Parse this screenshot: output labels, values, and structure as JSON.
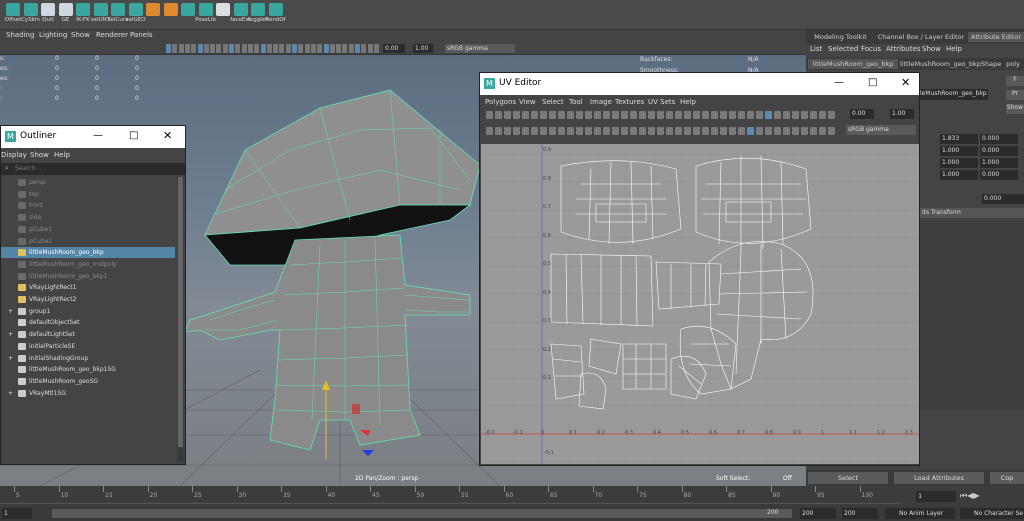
{
  "shelf": {
    "items": [
      {
        "label": "Offset",
        "icon": "teal-cube-icon",
        "color": "#3aa6a0"
      },
      {
        "label": "CySkin",
        "icon": "teal-cube-icon",
        "color": "#3aa6a0"
      },
      {
        "label": "Outl",
        "icon": "outliner-icon",
        "color": "#cfd8e0"
      },
      {
        "label": "GE",
        "icon": "graph-editor-icon",
        "color": "#cfd8e0"
      },
      {
        "label": "IK-FK",
        "icon": "teal-cube-icon",
        "color": "#3aa6a0"
      },
      {
        "label": "selUNT",
        "icon": "teal-cube-icon",
        "color": "#3aa6a0"
      },
      {
        "label": "selCurv",
        "icon": "teal-cube-icon",
        "color": "#3aa6a0"
      },
      {
        "label": "selGEO",
        "icon": "teal-cube-icon",
        "color": "#3aa6a0"
      },
      {
        "label": "",
        "icon": "orange-cube-icon",
        "color": "#e08a30"
      },
      {
        "label": "",
        "icon": "orange-cube-icon",
        "color": "#e08a30"
      },
      {
        "label": "",
        "icon": "teal-cube-icon",
        "color": "#3aa6a0"
      },
      {
        "label": "PoseLib",
        "icon": "teal-cube-icon",
        "color": "#3aa6a0"
      },
      {
        "label": "",
        "icon": "magnet-icon",
        "color": "#dddddd"
      },
      {
        "label": "faceExt",
        "icon": "teal-cube-icon",
        "color": "#3aa6a0"
      },
      {
        "label": "toggleF",
        "icon": "teal-cube-icon",
        "color": "#3aa6a0"
      },
      {
        "label": "RendOf",
        "icon": "teal-cube-icon",
        "color": "#3aa6a0"
      }
    ]
  },
  "viewport": {
    "menu": [
      "Shading",
      "Lighting",
      "Show",
      "Renderer",
      "Panels"
    ],
    "exposure": "0.00",
    "gamma": "1.00",
    "colorspace": "sRGB gamma",
    "hud_left": [
      {
        "label": "s:",
        "a": "0",
        "b": "0",
        "c": "0"
      },
      {
        "label": "es:",
        "a": "0",
        "b": "0",
        "c": "0"
      },
      {
        "label": "es:",
        "a": "0",
        "b": "0",
        "c": "0"
      },
      {
        "label": ":",
        "a": "0",
        "b": "0",
        "c": "0"
      },
      {
        "label": ":",
        "a": "0",
        "b": "0",
        "c": "0"
      }
    ],
    "hud_right": [
      {
        "label": "Backfaces:",
        "value": "N/A"
      },
      {
        "label": "Smoothness:",
        "value": "N/A"
      }
    ],
    "status_center": "2D Pan/Zoom : persp",
    "soft_select_label": "Soft Select:",
    "soft_select_value": "Off"
  },
  "right_panel": {
    "tabs": [
      "Modeling Toolkit",
      "Channel Box / Layer Editor",
      "Attribute Editor"
    ],
    "menu": [
      "List",
      "Selected",
      "Focus",
      "Attributes",
      "Show",
      "Help"
    ],
    "node_tabs": [
      "littleMushRoom_geo_bkp",
      "littleMushRoom_geo_bkpShape",
      "poly"
    ],
    "node_field": "leMushRoom_geo_bkp",
    "side_btns": [
      "F",
      "Pr",
      "Show"
    ],
    "values": [
      [
        "1.833",
        "0.000"
      ],
      [
        "1.000",
        "0.000"
      ],
      [
        "1.000",
        "1.000"
      ],
      [
        "1.000",
        "0.000"
      ]
    ],
    "single_value": "0.000",
    "transform_label": "its Transform",
    "bottom_buttons": [
      "Select",
      "Load Attributes",
      "Cop"
    ]
  },
  "outliner": {
    "title": "Outliner",
    "menu": [
      "Display",
      "Show",
      "Help"
    ],
    "search_placeholder": "Search...",
    "items": [
      {
        "label": "persp",
        "style": "dim",
        "expand": ""
      },
      {
        "label": "top",
        "style": "dim",
        "expand": ""
      },
      {
        "label": "front",
        "style": "dim",
        "expand": ""
      },
      {
        "label": "side",
        "style": "dim",
        "expand": ""
      },
      {
        "label": "pCube1",
        "style": "dim",
        "expand": ""
      },
      {
        "label": "pCube2",
        "style": "dim",
        "expand": ""
      },
      {
        "label": "littleMushRoom_geo_bkp",
        "style": "sel",
        "expand": ""
      },
      {
        "label": "littleMushRoom_geo_midpoly",
        "style": "dim",
        "expand": ""
      },
      {
        "label": "littleMushRoom_geo_bkp1",
        "style": "dim",
        "expand": ""
      },
      {
        "label": "VRayLightRect1",
        "style": "",
        "expand": ""
      },
      {
        "label": "VRayLightRect2",
        "style": "",
        "expand": ""
      },
      {
        "label": "group1",
        "style": "",
        "expand": "+"
      },
      {
        "label": "defaultObjectSet",
        "style": "",
        "expand": ""
      },
      {
        "label": "defaultLightSet",
        "style": "",
        "expand": "+"
      },
      {
        "label": "initialParticleSE",
        "style": "",
        "expand": ""
      },
      {
        "label": "initialShadingGroup",
        "style": "",
        "expand": "+"
      },
      {
        "label": "littleMushRoom_geo_bkp1SG",
        "style": "",
        "expand": ""
      },
      {
        "label": "littleMushRoom_geoSG",
        "style": "",
        "expand": ""
      },
      {
        "label": "VRayMtl1SG",
        "style": "",
        "expand": "+"
      }
    ]
  },
  "uv_editor": {
    "title": "UV Editor",
    "menu": [
      "Polygons",
      "View",
      "Select",
      "Tool",
      "Image",
      "Textures",
      "UV Sets",
      "Help"
    ],
    "exposure": "0.00",
    "gamma": "1.00",
    "colorspace": "sRGB gamma",
    "v_ticks": [
      "0.9",
      "0.8",
      "0.7",
      "0.6",
      "0.5",
      "0.4",
      "0.3",
      "0.2",
      "0.1"
    ],
    "u_ticks": [
      "-0.2",
      "-0.1",
      "0",
      "0.1",
      "0.2",
      "0.3",
      "0.4",
      "0.5",
      "0.6",
      "0.7",
      "0.8",
      "0.9",
      "1",
      "1.1",
      "1.2",
      "1.3"
    ],
    "bottom_label": "-0.1"
  },
  "timeline": {
    "ticks": [
      "5",
      "10",
      "15",
      "20",
      "25",
      "30",
      "35",
      "40",
      "45",
      "50",
      "55",
      "60",
      "65",
      "70",
      "75",
      "80",
      "85",
      "90",
      "95",
      "100"
    ],
    "current_frame": "1",
    "range_start": "1",
    "range_end": "200",
    "end_a": "200",
    "end_b": "200",
    "anim_layer": "No Anim Layer",
    "char_set": "No Character Se"
  },
  "colors": {
    "accent": "#5285a6",
    "wire": "#5de4b0",
    "uv_bg": "#9a9a9a"
  }
}
